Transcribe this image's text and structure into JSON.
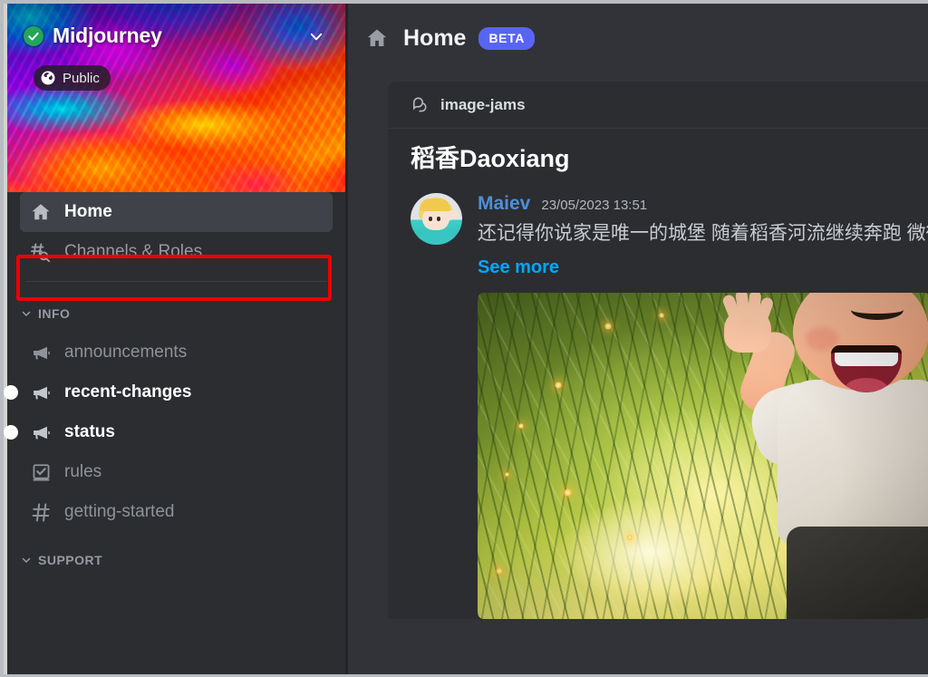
{
  "window": {
    "border_color": "#d3d3d3"
  },
  "sidebar": {
    "server": {
      "name": "Midjourney",
      "verified_icon": "verified-check-icon",
      "dropdown_icon": "chevron-down-icon",
      "privacy_badge": {
        "label": "Public",
        "icon": "globe-icon"
      }
    },
    "nav_items": [
      {
        "label": "Home",
        "icon": "home-icon",
        "active": true
      },
      {
        "label": "Channels & Roles",
        "icon": "hashtag-search-icon",
        "active": false
      }
    ],
    "categories": [
      {
        "label": "INFO",
        "caret_icon": "chevron-down-icon",
        "channels": [
          {
            "label": "announcements",
            "icon": "announcement-megaphone-icon",
            "unread": false
          },
          {
            "label": "recent-changes",
            "icon": "announcement-megaphone-icon",
            "unread": true
          },
          {
            "label": "status",
            "icon": "announcement-megaphone-icon",
            "unread": true
          },
          {
            "label": "rules",
            "icon": "rules-book-icon",
            "unread": false
          },
          {
            "label": "getting-started",
            "icon": "hashtag-icon",
            "unread": false
          }
        ]
      },
      {
        "label": "SUPPORT",
        "caret_icon": "chevron-down-icon",
        "channels": []
      }
    ],
    "annotation": {
      "target": "Channels & Roles",
      "color": "#ee0000"
    }
  },
  "main": {
    "header": {
      "icon": "home-icon",
      "title": "Home",
      "badge": "BETA",
      "badge_color": "#5865f2"
    },
    "post": {
      "channel": {
        "name": "image-jams",
        "icon": "forum-threads-icon"
      },
      "title": "稻香Daoxiang",
      "message": {
        "author": "Maiev",
        "author_color": "#4f8fd6",
        "timestamp": "23/05/2023 13:51",
        "text": "还记得你说家是唯一的城堡 随着稻香河流继续奔跑 微微笑 小时候的梦我知道...",
        "see_more_label": "See more",
        "see_more_color": "#00a8fc",
        "avatar": "user-avatar"
      },
      "attachment": {
        "name": "attachment-image"
      }
    }
  }
}
